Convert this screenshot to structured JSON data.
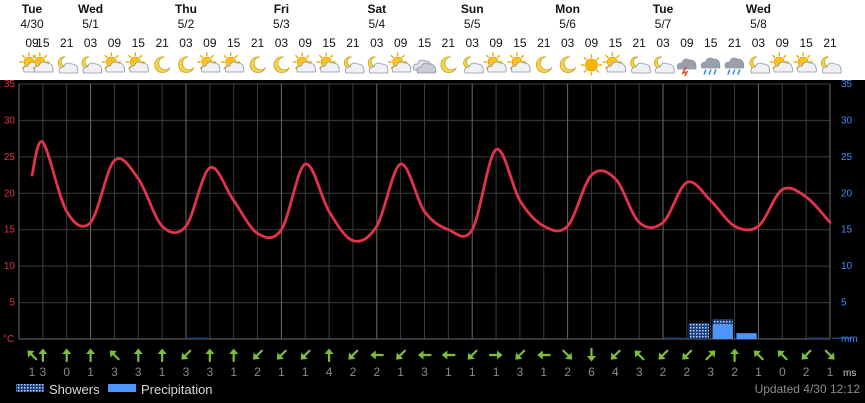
{
  "days": [
    {
      "day": "Tue",
      "date": "4/30",
      "hour": "09"
    },
    {
      "day": "Wed",
      "date": "5/1",
      "hour": "03"
    },
    {
      "day": "Thu",
      "date": "5/2",
      "hour": "03"
    },
    {
      "day": "Fri",
      "date": "5/3",
      "hour": "03"
    },
    {
      "day": "Sat",
      "date": "5/4",
      "hour": "03"
    },
    {
      "day": "Sun",
      "date": "5/5",
      "hour": "03"
    },
    {
      "day": "Mon",
      "date": "5/6",
      "hour": "03"
    },
    {
      "day": "Tue",
      "date": "5/7",
      "hour": "03"
    },
    {
      "day": "Wed",
      "date": "5/8",
      "hour": "03"
    }
  ],
  "hours": [
    "09",
    "15",
    "21",
    "03",
    "09",
    "15",
    "21",
    "03",
    "09",
    "15",
    "21",
    "03",
    "09",
    "15",
    "21",
    "03",
    "09",
    "15",
    "21",
    "03",
    "09",
    "15",
    "21",
    "03",
    "09",
    "15",
    "21",
    "03",
    "09",
    "15",
    "21",
    "03",
    "09",
    "15",
    "21"
  ],
  "weather_icons": [
    "partly-cloudy-day",
    "partly-cloudy-day",
    "partly-cloudy-night",
    "partly-cloudy-night",
    "partly-cloudy-day",
    "partly-cloudy-day",
    "clear-night",
    "clear-night",
    "partly-cloudy-day",
    "partly-cloudy-day",
    "clear-night",
    "clear-night",
    "partly-sunny",
    "partly-cloudy-day",
    "partly-cloudy-night",
    "partly-cloudy-night",
    "partly-cloudy-day",
    "cloudy",
    "clear-night",
    "partly-cloudy-night",
    "partly-cloudy-day",
    "partly-cloudy-day",
    "clear-night",
    "clear-night",
    "sunny",
    "partly-cloudy-day",
    "partly-cloudy-night",
    "partly-cloudy-night",
    "thunderstorm",
    "rain-showers",
    "rain-showers",
    "partly-cloudy-night",
    "partly-cloudy-day",
    "partly-cloudy-day",
    "partly-cloudy-night"
  ],
  "wind": {
    "directions_deg": [
      135,
      180,
      180,
      180,
      135,
      180,
      180,
      45,
      180,
      180,
      45,
      45,
      45,
      180,
      45,
      90,
      45,
      90,
      90,
      45,
      270,
      45,
      90,
      315,
      0,
      45,
      135,
      45,
      45,
      225,
      180,
      135,
      135,
      45,
      315
    ],
    "speeds": [
      "1",
      "3",
      "0",
      "1",
      "3",
      "3",
      "1",
      "3",
      "3",
      "1",
      "2",
      "1",
      "1",
      "4",
      "2",
      "2",
      "1",
      "3",
      "1",
      "1",
      "1",
      "3",
      "1",
      "2",
      "6",
      "4",
      "3",
      "2",
      "2",
      "3",
      "2",
      "1",
      "0",
      "2",
      "1"
    ]
  },
  "units": {
    "temp": "°C",
    "precip": "mm",
    "wind": "ms"
  },
  "legend": {
    "showers": "Showers",
    "precipitation": "Precipitation"
  },
  "updated": "Updated 4/30 12:12",
  "colors": {
    "background": "#000000",
    "grid": "#3c3c3c",
    "temperature": "#e2334a",
    "precipitation": "#4d94ff",
    "right_ticks": "#3a8dff",
    "wind_arrow": "#7cc03a"
  },
  "chart_data": {
    "type": "line",
    "x": [
      "4/30 09",
      "4/30 15",
      "4/30 21",
      "5/1 03",
      "5/1 09",
      "5/1 15",
      "5/1 21",
      "5/2 03",
      "5/2 09",
      "5/2 15",
      "5/2 21",
      "5/3 03",
      "5/3 09",
      "5/3 15",
      "5/3 21",
      "5/4 03",
      "5/4 09",
      "5/4 15",
      "5/4 21",
      "5/5 03",
      "5/5 09",
      "5/5 15",
      "5/5 21",
      "5/6 03",
      "5/6 09",
      "5/6 15",
      "5/6 21",
      "5/7 03",
      "5/7 09",
      "5/7 15",
      "5/7 21",
      "5/8 03",
      "5/8 09",
      "5/8 15",
      "5/8 21"
    ],
    "series": [
      {
        "name": "",
        "unit": "°C",
        "values": [
          22.5,
          27,
          17.5,
          16,
          24.5,
          22,
          15.5,
          15.5,
          23.5,
          19,
          14.5,
          15,
          24,
          17.5,
          13.5,
          15.5,
          24,
          17.5,
          15,
          15,
          26,
          19,
          15.5,
          15.5,
          22.5,
          22,
          16,
          16,
          21.5,
          19,
          15.5,
          15.5,
          20.5,
          19.5,
          16
        ]
      },
      {
        "name": "Precipitation",
        "unit": "mm",
        "values": [
          0,
          0,
          0,
          0,
          0,
          0,
          0,
          0,
          0,
          0,
          0,
          0,
          0,
          0,
          0,
          0,
          0,
          0,
          0,
          0,
          0,
          0,
          0,
          0,
          0,
          0,
          0,
          0,
          0,
          2,
          0.8,
          0,
          0,
          0,
          0
        ]
      },
      {
        "name": "Showers",
        "unit": "mm",
        "values": [
          0,
          0,
          0,
          0,
          0,
          0,
          0,
          0.1,
          0,
          0,
          0,
          0,
          0,
          0,
          0,
          0,
          0,
          0,
          0,
          0,
          0,
          0,
          0,
          0,
          0,
          0,
          0,
          0.1,
          2.2,
          2.7,
          0,
          0,
          0,
          0.1,
          0.1
        ]
      }
    ],
    "ylim_left": [
      0,
      35
    ],
    "ylim_right": [
      0,
      35
    ],
    "yticks": [
      5,
      10,
      15,
      20,
      25,
      30,
      35
    ],
    "grid": true,
    "legend_position": "bottom-left"
  }
}
